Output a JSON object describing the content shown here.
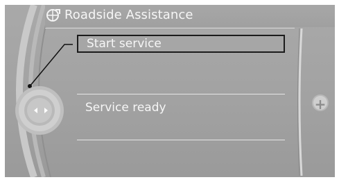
{
  "header": {
    "title": "Roadside Assistance",
    "icon": "roadside-assistance-icon"
  },
  "menu": {
    "items": [
      {
        "label": "Start service",
        "selected": true
      },
      {
        "label": "Service ready",
        "selected": false
      }
    ]
  },
  "controller": {
    "icon": "controller-knob-icon"
  },
  "side_button": {
    "icon": "plus-icon",
    "label": "+"
  },
  "colors": {
    "background": "#a3a3a3",
    "text": "#f6f6f6",
    "selection_border": "#1b1b1b"
  }
}
